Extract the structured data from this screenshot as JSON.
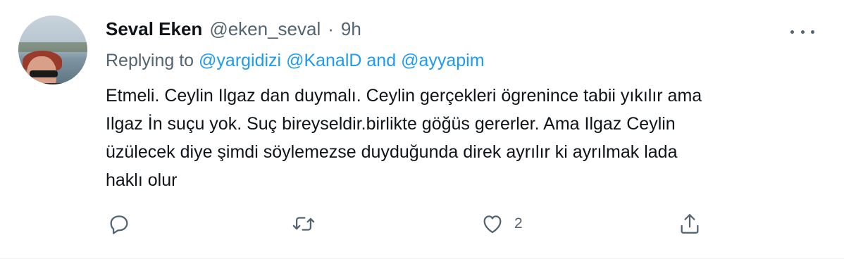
{
  "author": {
    "name": "Seval Eken",
    "handle": "@eken_seval",
    "separator": "·",
    "time": "9h"
  },
  "reply": {
    "prefix": "Replying to",
    "mention1": "@yargidizi",
    "mention2": "@KanalD",
    "joiner": "and",
    "mention3": "@ayyapim"
  },
  "tweet": {
    "lines": [
      "Etmeli. Ceylin Ilgaz dan duymalı. Ceylin gerçekleri ögrenince tabii yıkılır ama",
      "Ilgaz İn suçu yok. Suç bireyseldir.birlikte göğüs gererler. Ama Ilgaz Ceylin",
      "üzülecek diye şimdi söylemezse duyduğunda direk ayrılır ki ayrılmak lada",
      "haklı olur"
    ]
  },
  "actions": {
    "reply_icon": "reply-icon",
    "retweet_icon": "retweet-icon",
    "like_icon": "heart-icon",
    "like_count": "2",
    "share_icon": "share-icon"
  },
  "colors": {
    "link": "#1d9bf0",
    "secondary": "#536471",
    "text": "#0f1419"
  }
}
